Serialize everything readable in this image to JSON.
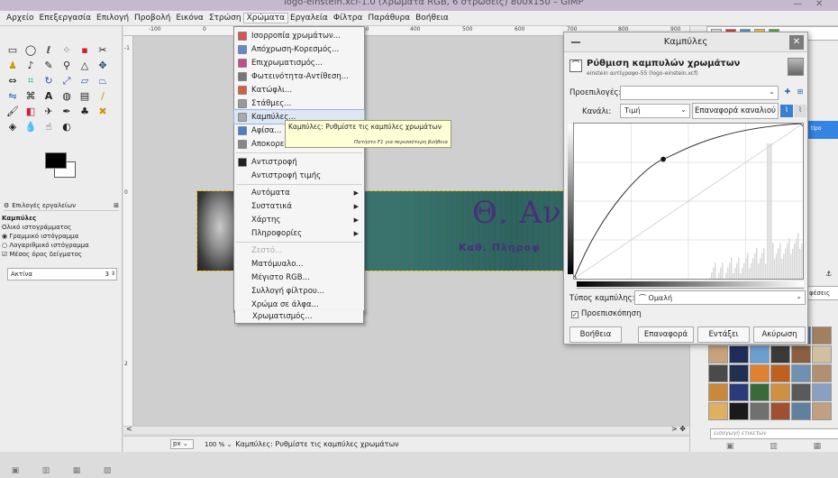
{
  "window": {
    "title": "logo-einstein.xcf-1.0 (Χρώματα RGB, 6 στρώσεις) 800x150 – GIMP"
  },
  "menubar": [
    "Αρχείο",
    "Επεξεργασία",
    "Επιλογή",
    "Προβολή",
    "Εικόνα",
    "Στρώση",
    "Χρώματα",
    "Εργαλεία",
    "Φίλτρα",
    "Παράθυρα",
    "Βοήθεια"
  ],
  "colors_menu": {
    "items": [
      {
        "label": "Ισορροπία χρωμάτων...",
        "icon": "color-balance-icon",
        "color": "#d9534f"
      },
      {
        "label": "Απόχρωση-Κορεσμός...",
        "icon": "hue-saturation-icon",
        "color": "#5b8bd0"
      },
      {
        "label": "Επιχρωματισμός...",
        "icon": "colorize-icon",
        "color": "#c84b8c"
      },
      {
        "label": "Φωτεινότητα-Αντίθεση...",
        "icon": "brightness-contrast-icon",
        "color": "#777777"
      },
      {
        "label": "Κατώφλι...",
        "icon": "threshold-icon",
        "color": "#d95f3a"
      },
      {
        "label": "Στάθμες...",
        "icon": "levels-icon",
        "color": "#999999"
      },
      {
        "label": "Καμπύλες...",
        "icon": "curves-icon",
        "color": "#aaaaaa"
      },
      {
        "label": "Αφίσα...",
        "icon": "posterize-icon",
        "color": "#4a7fc9"
      },
      {
        "label": "Αποκορεσμός",
        "icon": "desaturate-icon",
        "color": "#888888"
      }
    ],
    "items2": [
      {
        "label": "Αντιστροφή",
        "icon": "invert-icon"
      },
      {
        "label": "Αντιστροφή τιμής"
      }
    ],
    "submenus": [
      "Αυτόματα",
      "Συστατικά",
      "Χάρτης",
      "Πληροφορίες"
    ],
    "items3": [
      {
        "label": "Ζεστό...",
        "disabled": true
      },
      {
        "label": "Ματόμυαλο..."
      },
      {
        "label": "Μέγιστο RGB..."
      },
      {
        "label": "Συλλογή φίλτρου..."
      },
      {
        "label": "Χρώμα σε άλφα..."
      },
      {
        "label": "Χρωματισμός..."
      }
    ]
  },
  "tooltip": {
    "text": "Καμπύλες: Ρυθμίστε τις καμπύλες χρωμάτων",
    "help": "Πατήστε F1 για περισσότερη βοήθεια"
  },
  "toolbox": {
    "tab": "Επιλογές εργαλείων",
    "options_title": "Καμπύλες",
    "histogram_label": "Ολικό ιστογράμματος",
    "radio1": "Γραμμικό ιστόγραμμα",
    "radio2": "Λογαριθμικό ιστόγραμμα",
    "sample_average": "Μέσος όρος δείγματος",
    "radius_label": "Ακτίνα",
    "radius_value": "3"
  },
  "image": {
    "title_text": "Θ. Αν",
    "subtitle_text": "Καθ. Πληροφ"
  },
  "status": {
    "unit": "px",
    "zoom": "100 %",
    "message": "Καμπύλες: Ρυθμίστε τις καμπύλες χρωμάτων"
  },
  "ruler": {
    "h": [
      "-100",
      "0",
      "100",
      "200",
      "300",
      "400",
      "500",
      "600",
      "700",
      "800",
      "900"
    ]
  },
  "dialog": {
    "title": "Καμπύλες",
    "heading": "Ρύθμιση καμπυλών χρωμάτων",
    "subheading": "einstein αντίγραφο-55 (logo-einstein.xcf)",
    "presets_label": "Προεπιλογές:",
    "channel_label": "Κανάλι:",
    "channel_value": "Τιμή",
    "reset_channel": "Επαναφορά καναλιού",
    "curve_type_label": "Τύπος καμπύλης:",
    "curve_type_value": "Ομαλή",
    "preview_label": "Προεπισκόπηση",
    "buttons": {
      "help": "Βοήθεια",
      "reset": "Επαναφορά",
      "ok": "Εντάξει",
      "cancel": "Ακύρωση"
    }
  },
  "curve_points": [
    {
      "in": 0,
      "out": 0
    },
    {
      "in": 0.39,
      "out": 0.77
    },
    {
      "in": 1,
      "out": 1
    }
  ],
  "rightdock": {
    "selected_label": "tipo",
    "blend_label": "φέσεις",
    "tag_placeholder": "εισαγωγή ετικετών"
  }
}
